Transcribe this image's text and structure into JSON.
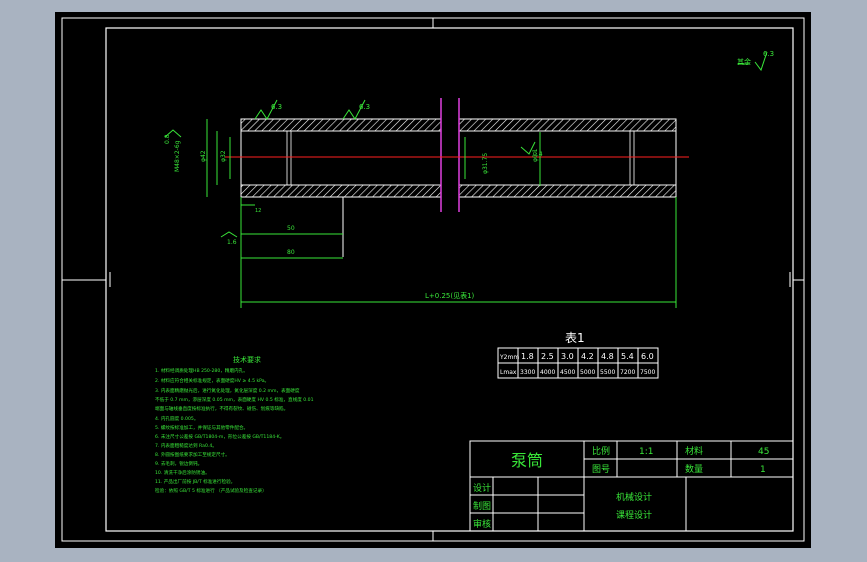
{
  "drawing": {
    "part_name": "泵筒",
    "roughness_general": "6.3",
    "roughness_general_prefix": "其余",
    "roughness_1": "6.3",
    "roughness_2": "6.3",
    "roughness_3": "1.6",
    "roughness_4": "0.4",
    "roughness_left": "0.8",
    "dimension_total": "L+0.25(见表1)",
    "dimension_short_1": "50",
    "dimension_short_2": "80",
    "dimension_small": "12",
    "dim_thread": "M48×2-6g",
    "dim_dia_1": "φ42",
    "dim_dia_2": "φ32",
    "dim_inner": "φ31.75",
    "dim_inner_2": "φ0.1"
  },
  "table1": {
    "title": "表1",
    "row1_header": "Y2mm",
    "row1": [
      "1.8",
      "2.5",
      "3.0",
      "4.2",
      "4.8",
      "5.4",
      "6.0"
    ],
    "row2_header": "Lmax",
    "row2": [
      "3300",
      "4000",
      "4500",
      "5000",
      "5500",
      "7200",
      "7500"
    ]
  },
  "tech_req": {
    "title": "技术要求",
    "lines": [
      "1. 材料经调质处理HB 250-280，精磨内孔。",
      "2. 材料应符合相关标准规定，表面硬度HV ≥ 4.5 kPa。",
      "3. 内表面精磨抛光后，进行氮化处理，氮化层深度 0.2 mm，表面硬度",
      "   不低于 0.7 mm，渗层深度 0.05 mm，表面硬度 HV 0.5 标准，直线度 0.01",
      "   端面与轴线垂直度按标准执行，不得有裂纹、碰伤、划痕等缺陷。",
      "4. 内孔圆度 0.005。",
      "5. 螺纹按标准加工，并保证与其他零件配合。",
      "6. 未注尺寸公差按 GB/T1804-m，形位公差按 GB/T1184-K。",
      "7. 内表面粗糙度达到 Ra0.4。",
      "8. 外圆按图纸要求加工至规定尺寸。",
      "9. 去毛刺，锐边倒钝。",
      "10. 清洗干净后涂防锈油。",
      "11. 产品出厂前按 JB/T 标准进行检验。",
      "    检验：依照 GB/T 5 标准进行            （产品试验及检查记录）"
    ]
  },
  "title_block": {
    "scale_label": "比例",
    "scale_value": "1:1",
    "material_label": "材料",
    "material_value": "45",
    "drawing_no_label": "图号",
    "quantity_label": "数量",
    "quantity_value": "1",
    "design_label": "设计",
    "draw_label": "制图",
    "review_label": "审核",
    "company_line1": "机械设计",
    "company_line2": "课程设计"
  },
  "colors": {
    "background": "#000000",
    "line_white": "#ffffff",
    "line_green": "#39e639",
    "center_red": "#ff2020",
    "magenta": "#e040e0",
    "frame_outer": "#a9b3c1"
  }
}
